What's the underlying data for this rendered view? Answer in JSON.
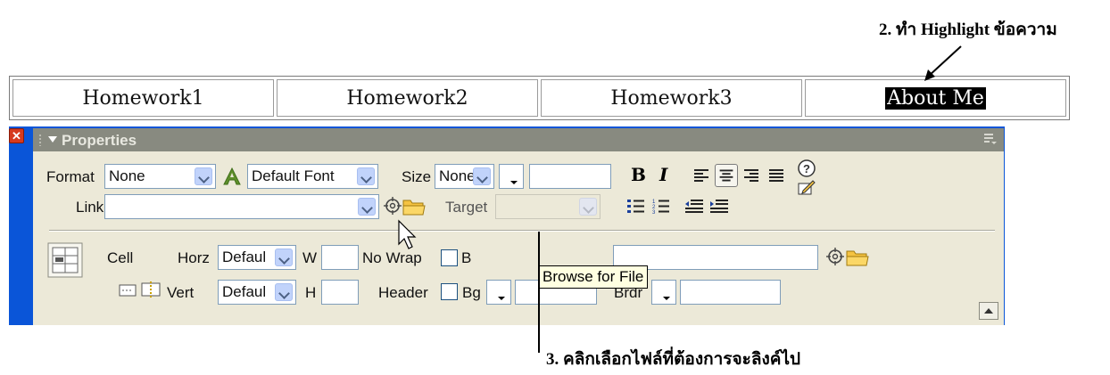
{
  "annotations": {
    "top": "2. ทำ Highlight ข้อความ",
    "bottom": "3. คลิกเลือกไฟล์ที่ต้องการจะลิงค์ไป"
  },
  "nav": {
    "cells": [
      {
        "label": "Homework1",
        "highlighted": false
      },
      {
        "label": "Homework2",
        "highlighted": false
      },
      {
        "label": "Homework3",
        "highlighted": false
      },
      {
        "label": "About Me",
        "highlighted": true
      }
    ]
  },
  "panel": {
    "title": "Properties",
    "row1": {
      "format_label": "Format",
      "format_value": "None",
      "font_value": "Default Font",
      "size_label": "Size",
      "size_value": "None",
      "link_label": "Link",
      "link_value": "",
      "target_label": "Target",
      "target_value": ""
    },
    "row2": {
      "cell_label": "Cell",
      "horz_label": "Horz",
      "horz_value": "Defaul",
      "vert_label": "Vert",
      "vert_value": "Defaul",
      "w_label": "W",
      "h_label": "H",
      "nowrap_label": "No Wrap",
      "header_label": "Header",
      "bg_label": "Bg",
      "bg_partial_label": "B",
      "brdr_label": "Brdr"
    },
    "tooltip": "Browse for File"
  },
  "colors": {
    "panel_border": "#0a55d8",
    "title_bar": "#888a80",
    "panel_body": "#ece9d8",
    "close_button": "#d63a1e",
    "tooltip_bg": "#ffffe1"
  }
}
